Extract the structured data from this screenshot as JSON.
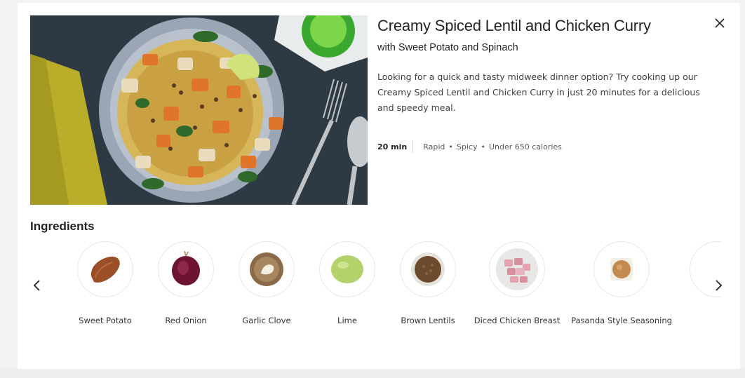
{
  "recipe": {
    "title": "Creamy Spiced Lentil and Chicken Curry",
    "subtitle": "with Sweet Potato and Spinach",
    "description": "Looking for a quick and tasty midweek dinner option? Try cooking up our Creamy Spiced Lentil and Chicken Curry in just 20 minutes for a delicious and speedy meal.",
    "time": "20 min",
    "tags": [
      "Rapid",
      "Spicy",
      "Under 650 calories"
    ]
  },
  "ingredients_section": {
    "heading": "Ingredients",
    "items": [
      {
        "name": "Sweet Potato",
        "icon": "sweet-potato-icon",
        "color": "#a0562c"
      },
      {
        "name": "Red Onion",
        "icon": "red-onion-icon",
        "color": "#7a1630"
      },
      {
        "name": "Garlic Clove",
        "icon": "garlic-clove-icon",
        "color": "#8a6a4a"
      },
      {
        "name": "Lime",
        "icon": "lime-icon",
        "color": "#b8d46a"
      },
      {
        "name": "Brown Lentils",
        "icon": "brown-lentils-icon",
        "color": "#6b4a2e"
      },
      {
        "name": "Diced Chicken Breast",
        "icon": "diced-chicken-icon",
        "color": "#e2a6b0"
      },
      {
        "name": "Pasanda Style Seasoning",
        "icon": "seasoning-icon",
        "color": "#c48a52"
      }
    ]
  },
  "icons": {
    "close": "close-icon",
    "prev": "chevron-left-icon",
    "next": "chevron-right-icon"
  }
}
